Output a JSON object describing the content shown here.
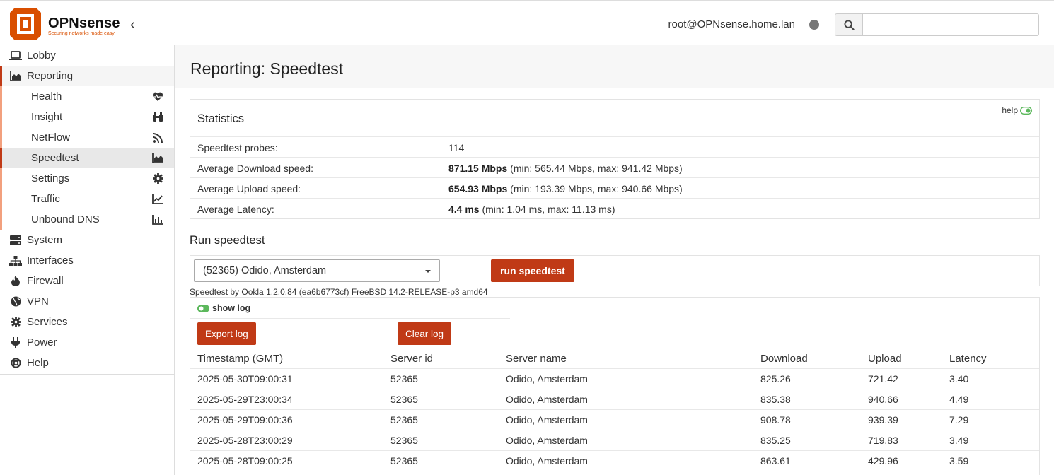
{
  "header": {
    "brand_name": "OPNsense",
    "brand_tagline": "Securing networks made easy",
    "user": "root@OPNsense.home.lan",
    "search_placeholder": "",
    "colors": {
      "accent": "#c03a16",
      "logo": "#d94f00"
    }
  },
  "sidebar": {
    "items": [
      {
        "label": "Lobby",
        "icon": "laptop-icon"
      },
      {
        "label": "Reporting",
        "icon": "area-chart-icon"
      },
      {
        "label": "System",
        "icon": "server-icon"
      },
      {
        "label": "Interfaces",
        "icon": "sitemap-icon"
      },
      {
        "label": "Firewall",
        "icon": "fire-icon"
      },
      {
        "label": "VPN",
        "icon": "globe-icon"
      },
      {
        "label": "Services",
        "icon": "gear-icon"
      },
      {
        "label": "Power",
        "icon": "plug-icon"
      },
      {
        "label": "Help",
        "icon": "lifebuoy-icon"
      }
    ],
    "reporting_sub": [
      {
        "label": "Health",
        "icon": "heartbeat-icon"
      },
      {
        "label": "Insight",
        "icon": "binoculars-icon"
      },
      {
        "label": "NetFlow",
        "icon": "rss-icon"
      },
      {
        "label": "Speedtest",
        "icon": "area-chart-icon"
      },
      {
        "label": "Settings",
        "icon": "gear-icon"
      },
      {
        "label": "Traffic",
        "icon": "line-chart-icon"
      },
      {
        "label": "Unbound DNS",
        "icon": "bar-chart-icon"
      }
    ]
  },
  "page": {
    "title": "Reporting: Speedtest",
    "statistics": {
      "title": "Statistics",
      "help_label": "help",
      "rows": [
        {
          "label": "Speedtest probes:",
          "value": "114",
          "detail": ""
        },
        {
          "label": "Average Download speed:",
          "value": "871.15 Mbps",
          "detail": " (min: 565.44 Mbps, max: 941.42 Mbps)"
        },
        {
          "label": "Average Upload speed:",
          "value": "654.93 Mbps",
          "detail": " (min: 193.39 Mbps, max: 940.66 Mbps)"
        },
        {
          "label": "Average Latency:",
          "value": "4.4 ms",
          "detail": " (min: 1.04 ms, max: 11.13 ms)"
        }
      ]
    },
    "run": {
      "title": "Run speedtest",
      "selected_server": "(52365) Odido, Amsterdam",
      "run_button": "run speedtest",
      "version": "Speedtest by Ookla 1.2.0.84 (ea6b6773cf) FreeBSD 14.2-RELEASE-p3 amd64"
    },
    "log": {
      "show_log_label": "show log",
      "export_button": "Export log",
      "clear_button": "Clear log",
      "columns": [
        "Timestamp (GMT)",
        "Server id",
        "Server name",
        "Download",
        "Upload",
        "Latency"
      ],
      "rows": [
        [
          "2025-05-30T09:00:31",
          "52365",
          "Odido, Amsterdam",
          "825.26",
          "721.42",
          "3.40"
        ],
        [
          "2025-05-29T23:00:34",
          "52365",
          "Odido, Amsterdam",
          "835.38",
          "940.66",
          "4.49"
        ],
        [
          "2025-05-29T09:00:36",
          "52365",
          "Odido, Amsterdam",
          "908.78",
          "939.39",
          "7.29"
        ],
        [
          "2025-05-28T23:00:29",
          "52365",
          "Odido, Amsterdam",
          "835.25",
          "719.83",
          "3.49"
        ],
        [
          "2025-05-28T09:00:25",
          "52365",
          "Odido, Amsterdam",
          "863.61",
          "429.96",
          "3.59"
        ]
      ]
    }
  }
}
